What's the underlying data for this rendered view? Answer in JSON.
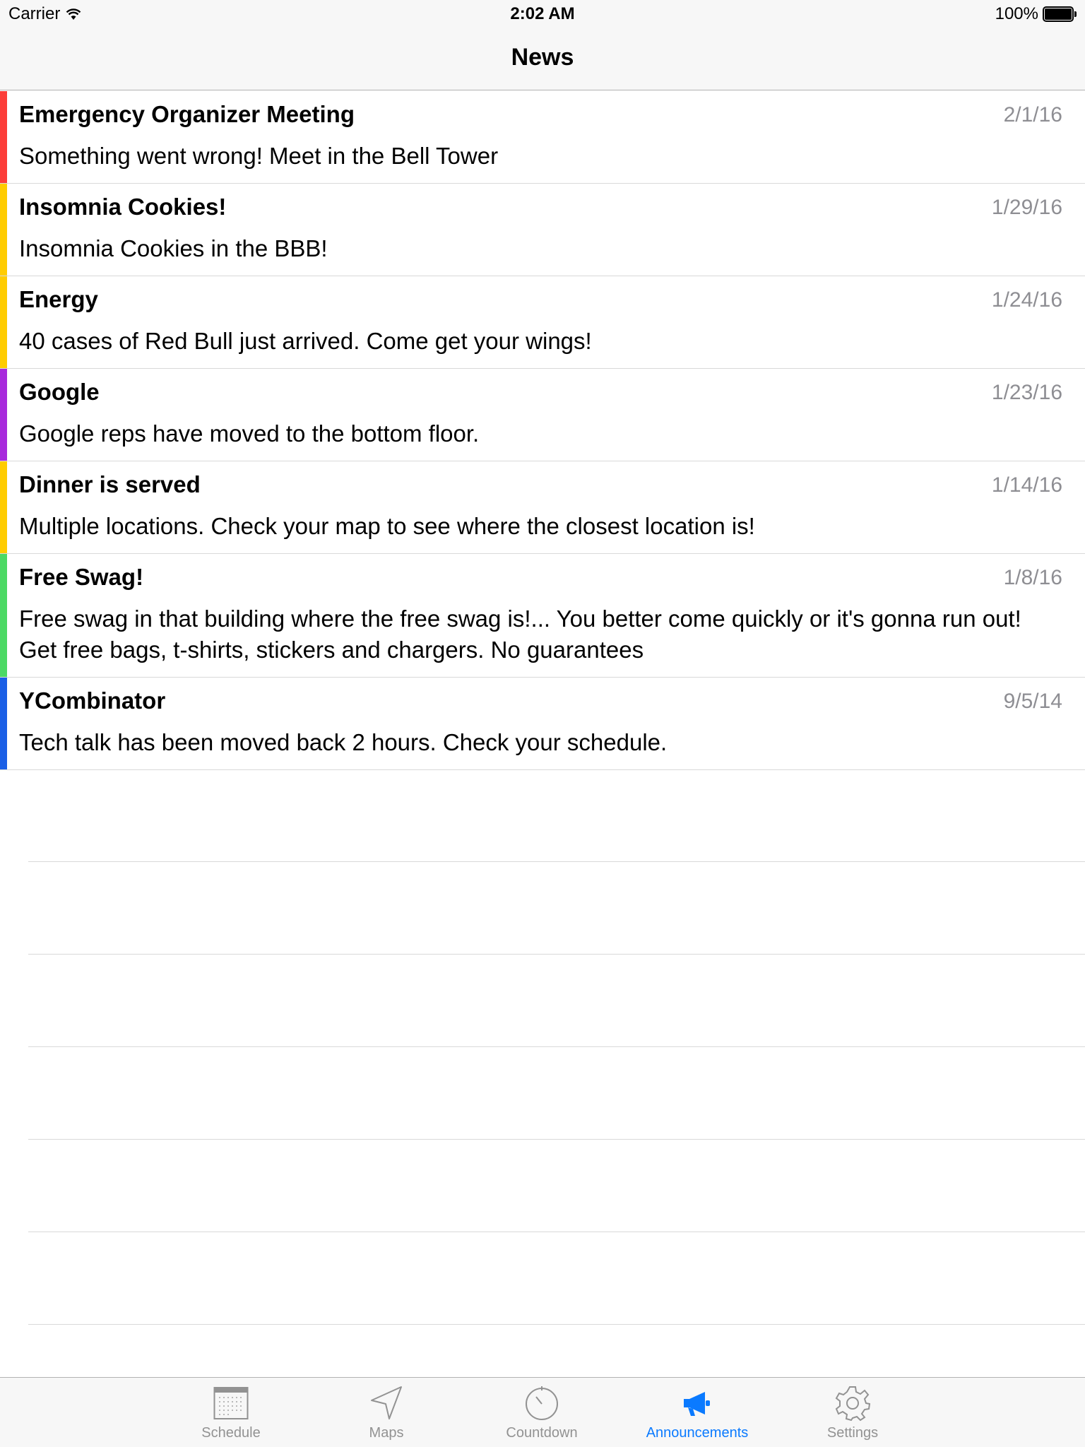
{
  "status_bar": {
    "carrier": "Carrier",
    "time": "2:02 AM",
    "battery": "100%"
  },
  "nav": {
    "title": "News"
  },
  "news": [
    {
      "title": "Emergency Organizer Meeting",
      "date": "2/1/16",
      "body": "Something went wrong! Meet in the Bell Tower",
      "color": "#fc3d39"
    },
    {
      "title": "Insomnia Cookies!",
      "date": "1/29/16",
      "body": "Insomnia Cookies in the BBB!",
      "color": "#ffcc00"
    },
    {
      "title": "Energy",
      "date": "1/24/16",
      "body": "40 cases of Red Bull just arrived. Come get your wings!",
      "color": "#ffcc00"
    },
    {
      "title": "Google",
      "date": "1/23/16",
      "body": "Google reps have moved to the bottom floor.",
      "color": "#a829dc"
    },
    {
      "title": "Dinner is served",
      "date": "1/14/16",
      "body": "Multiple locations. Check your map to see where the closest location is!",
      "color": "#ffcc00"
    },
    {
      "title": "Free Swag!",
      "date": "1/8/16",
      "body": "Free swag in that building where the free swag is!... You better come quickly or it's gonna run out! Get free bags, t-shirts, stickers and chargers. No guarantees",
      "color": "#4cd964"
    },
    {
      "title": "YCombinator",
      "date": "9/5/14",
      "body": "Tech talk has been moved back 2 hours. Check your schedule.",
      "color": "#1a5fe6"
    }
  ],
  "tabs": [
    {
      "label": "Schedule",
      "icon": "calendar-icon",
      "active": false
    },
    {
      "label": "Maps",
      "icon": "location-arrow-icon",
      "active": false
    },
    {
      "label": "Countdown",
      "icon": "timer-icon",
      "active": false
    },
    {
      "label": "Announcements",
      "icon": "megaphone-icon",
      "active": true
    },
    {
      "label": "Settings",
      "icon": "gear-icon",
      "active": false
    }
  ],
  "colors": {
    "accent": "#0a7aff",
    "inactive": "#929292"
  }
}
